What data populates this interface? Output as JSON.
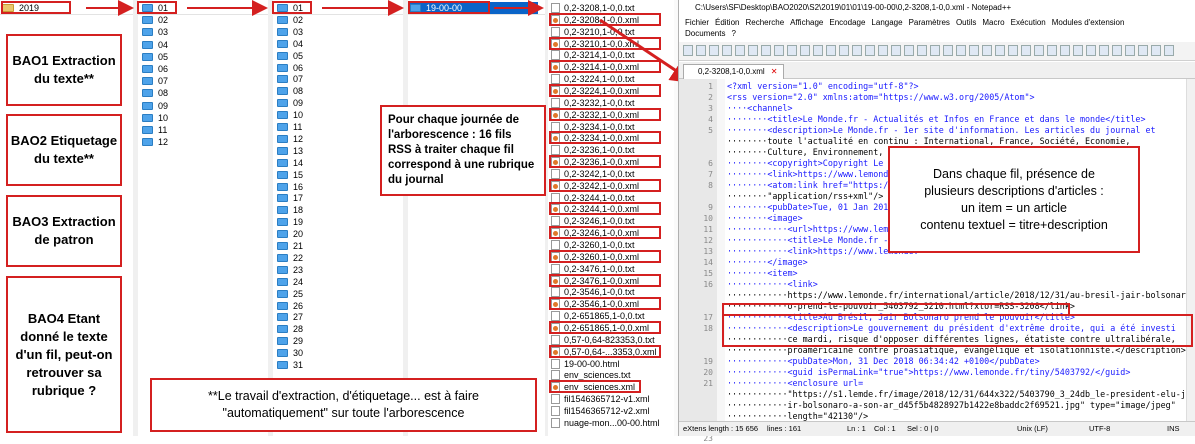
{
  "explorer": {
    "root_folder": "2019",
    "months": [
      "01",
      "02",
      "03",
      "04",
      "05",
      "06",
      "07",
      "08",
      "09",
      "10",
      "11",
      "12"
    ],
    "days": [
      "01",
      "02",
      "03",
      "04",
      "05",
      "06",
      "07",
      "08",
      "09",
      "10",
      "11",
      "12",
      "13",
      "14",
      "15",
      "16",
      "17",
      "18",
      "19",
      "20",
      "21",
      "22",
      "23",
      "24",
      "25",
      "26",
      "27",
      "28",
      "29",
      "30",
      "31"
    ],
    "hour_folder": "19-00-00",
    "files": [
      {
        "name": "0,2-3208,1-0,0.txt",
        "type": "txt"
      },
      {
        "name": "0,2-3208,1-0,0.xml",
        "type": "xml"
      },
      {
        "name": "0,2-3210,1-0,0.txt",
        "type": "txt"
      },
      {
        "name": "0,2-3210,1-0,0.xml",
        "type": "xml"
      },
      {
        "name": "0,2-3214,1-0,0.txt",
        "type": "txt"
      },
      {
        "name": "0,2-3214,1-0,0.xml",
        "type": "xml"
      },
      {
        "name": "0,2-3224,1-0,0.txt",
        "type": "txt"
      },
      {
        "name": "0,2-3224,1-0,0.xml",
        "type": "xml"
      },
      {
        "name": "0,2-3232,1-0,0.txt",
        "type": "txt"
      },
      {
        "name": "0,2-3232,1-0,0.xml",
        "type": "xml"
      },
      {
        "name": "0,2-3234,1-0,0.txt",
        "type": "txt"
      },
      {
        "name": "0,2-3234,1-0,0.xml",
        "type": "xml"
      },
      {
        "name": "0,2-3236,1-0,0.txt",
        "type": "txt"
      },
      {
        "name": "0,2-3236,1-0,0.xml",
        "type": "xml"
      },
      {
        "name": "0,2-3242,1-0,0.txt",
        "type": "txt"
      },
      {
        "name": "0,2-3242,1-0,0.xml",
        "type": "xml"
      },
      {
        "name": "0,2-3244,1-0,0.txt",
        "type": "txt"
      },
      {
        "name": "0,2-3244,1-0,0.xml",
        "type": "xml"
      },
      {
        "name": "0,2-3246,1-0,0.txt",
        "type": "txt"
      },
      {
        "name": "0,2-3246,1-0,0.xml",
        "type": "xml"
      },
      {
        "name": "0,2-3260,1-0,0.txt",
        "type": "txt"
      },
      {
        "name": "0,2-3260,1-0,0.xml",
        "type": "xml"
      },
      {
        "name": "0,2-3476,1-0,0.txt",
        "type": "txt"
      },
      {
        "name": "0,2-3476,1-0,0.xml",
        "type": "xml"
      },
      {
        "name": "0,2-3546,1-0,0.txt",
        "type": "txt"
      },
      {
        "name": "0,2-3546,1-0,0.xml",
        "type": "xml"
      },
      {
        "name": "0,2-651865,1-0,0.txt",
        "type": "txt"
      },
      {
        "name": "0,2-651865,1-0,0.xml",
        "type": "xml"
      },
      {
        "name": "0,57-0,64-823353,0.txt",
        "type": "txt"
      },
      {
        "name": "0,57-0,64-...3353,0.xml",
        "type": "xml"
      },
      {
        "name": "19-00-00.html",
        "type": "txt"
      },
      {
        "name": "env_sciences.txt",
        "type": "txt"
      },
      {
        "name": "env_sciences.xml",
        "type": "xml"
      },
      {
        "name": "fil1546365712-v1.xml",
        "type": "txt"
      },
      {
        "name": "fil1546365712-v2.xml",
        "type": "txt"
      },
      {
        "name": "nuage-mon...00-00.html",
        "type": "txt"
      }
    ]
  },
  "notes": {
    "bao1": "BAO1 Extraction du texte**",
    "bao2": "BAO2 Etiquetage du texte**",
    "bao3": "BAO3 Extraction de patron",
    "bao4": "BAO4 Etant donné le texte d'un fil, peut-on retrouver sa rubrique ?",
    "journee": "Pour chaque journée de l'arborescence : 16 fils RSS à traiter chaque fil correspond à une rubrique du journal",
    "footer_l1": "**Le travail d'extraction, d'étiquetage... est à faire",
    "footer_l2": "\"automatiquement\" sur toute l'arborescence",
    "callout_l1": "Dans chaque fil, présence de",
    "callout_l2": "plusieurs descriptions d'articles :",
    "callout_l3": "un item = un article",
    "callout_l4": "contenu textuel = titre+description"
  },
  "notepad": {
    "title": "C:\\Users\\SF\\Desktop\\BAO2020\\S2\\2019\\01\\01\\19-00-00\\0,2-3208,1-0,0.xml - Notepad++",
    "menu": [
      "Fichier",
      "Édition",
      "Recherche",
      "Affichage",
      "Encodage",
      "Langage",
      "Paramètres",
      "Outils",
      "Macro",
      "Exécution",
      "Modules d'extension",
      "Documents",
      "?"
    ],
    "tab_label": "0,2-3208,1-0,0.xml",
    "status": {
      "length": "eXtens length : 15 656",
      "lines": "lines : 161",
      "ln": "Ln : 1",
      "col": "Col : 1",
      "sel": "Sel : 0 | 0",
      "eol": "Unix (LF)",
      "encoding": "UTF-8",
      "mode": "INS"
    },
    "line_numbers": [
      "1",
      "2",
      "3",
      "4",
      "5",
      "6",
      "7",
      "8",
      "9",
      "10",
      "11",
      "12",
      "13",
      "14",
      "15",
      "16",
      "17",
      "18",
      "19",
      "20",
      "21",
      "22",
      "23"
    ],
    "code": {
      "l1a": "<?xml version=\"1.0\" encoding=\"utf-8\"?>",
      "l2": "<rss version=\"2.0\" xmlns:atom=\"https://www.w3.org/2005/Atom\">",
      "l3": "<channel>",
      "l4": "<title>Le Monde.fr - Actualités et Infos en France et dans le monde</title>",
      "l5a": "<description>Le Monde.fr - 1er site d'information. Les articles du journal et",
      "l5b": "toute l'actualité en continu : International, France, Société, Economie,",
      "l5c": "Culture, Environnement, Blo",
      "l6": "<copyright>Copyright Le Monde",
      "l7": "<link>https://www.lemonde.fr",
      "l8a": "<atom:link href=\"https://www",
      "l8b": "\"application/rss+xml\"/>",
      "l9": "<pubDate>Tue, 01 Jan 2019 1",
      "l10": "<image>",
      "l11": "<url>https://www.lemonde.f",
      "l12": "<title>Le Monde.fr - Actual",
      "l13": "<link>https://www.lemonde.",
      "l14": "</image>",
      "l15": "<item>",
      "l16a": "<link>",
      "l16b": "https://www.lemonde.fr/international/article/2018/12/31/au-bresil-jair-bolsonar",
      "l16c": "o-prend-le-pouvoir_5403792_3210.html?xtor=RSS-3208</link>",
      "l17": "<title>Au Brésil, Jair Bolsonaro prend le pouvoir</title>",
      "l18a": "<description>Le gouvernement du président d'extrême droite, qui a été investi",
      "l18b": "ce mardi, risque d'opposer différentes lignes, étatiste contre ultralibérale,",
      "l18c": "proaméricaine contre proasiatique, évangélique et isolationniste.</description>",
      "l19": "<pubDate>Mon, 31 Dec 2018 06:34:42 +0100</pubDate>",
      "l20": "<guid isPermaLink=\"true\">https://www.lemonde.fr/tiny/5403792/</guid>",
      "l21a": "<enclosure url=",
      "l21b": "\"https://s1.lemde.fr/image/2018/12/31/644x322/5403790_3_24db_le-president-elu-ja",
      "l21c": "ir-bolsonaro-a-son-ar_d45f5b4828927b1422e8baddc2f69521.jpg\" type=\"image/jpeg\"",
      "l21d": "length=\"42130\"/>",
      "l22": "</item>"
    }
  }
}
